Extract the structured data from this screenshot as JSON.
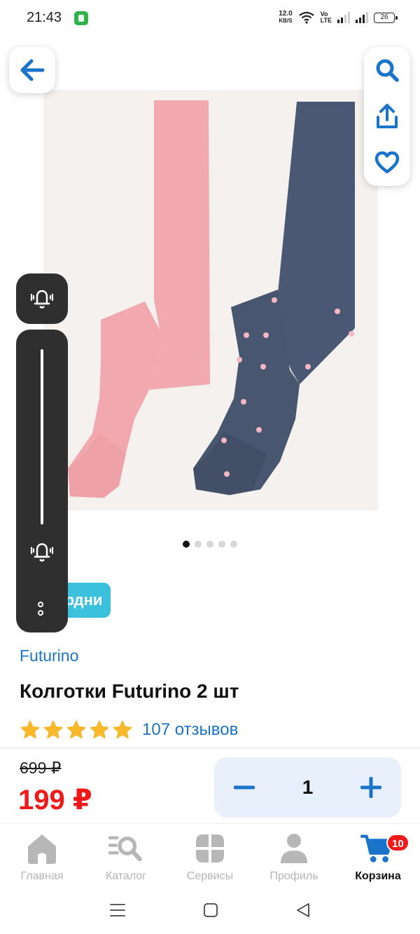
{
  "status_bar": {
    "time": "21:43",
    "speed_value": "12.0",
    "speed_unit": "KB/S",
    "volte_top": "Vo",
    "volte_bottom": "LTE",
    "battery": "26"
  },
  "header": {
    "back_icon": "arrow-left-icon",
    "actions": [
      "search-icon",
      "share-icon",
      "heart-icon"
    ]
  },
  "gallery": {
    "image_count": 5,
    "active_index": 0
  },
  "volume_overlay": {
    "level": 1.0,
    "icons": [
      "bell-vibrate-icon",
      "bell-vibrate-icon",
      "more-options-icon"
    ]
  },
  "product": {
    "promo_label": "Кибердни",
    "brand": "Futurino",
    "title": "Колготки Futurino 2 шт",
    "rating": 5,
    "reviews": "107 отзывов",
    "old_price": "699 ₽",
    "price": "199 ₽",
    "quantity": "1"
  },
  "colors": {
    "accent_blue": "#1a74c9",
    "price_red": "#f01a1a",
    "promo_cyan": "#3cc1dc",
    "star_yellow": "#f7b82c"
  },
  "bottom_nav": {
    "items": [
      {
        "label": "Главная",
        "icon": "home-icon"
      },
      {
        "label": "Каталог",
        "icon": "catalog-search-icon"
      },
      {
        "label": "Сервисы",
        "icon": "services-icon"
      },
      {
        "label": "Профиль",
        "icon": "profile-icon"
      },
      {
        "label": "Корзина",
        "icon": "cart-icon",
        "badge": "10",
        "active": true
      }
    ]
  },
  "system_nav": [
    "menu-icon",
    "home-square-icon",
    "back-triangle-icon"
  ]
}
